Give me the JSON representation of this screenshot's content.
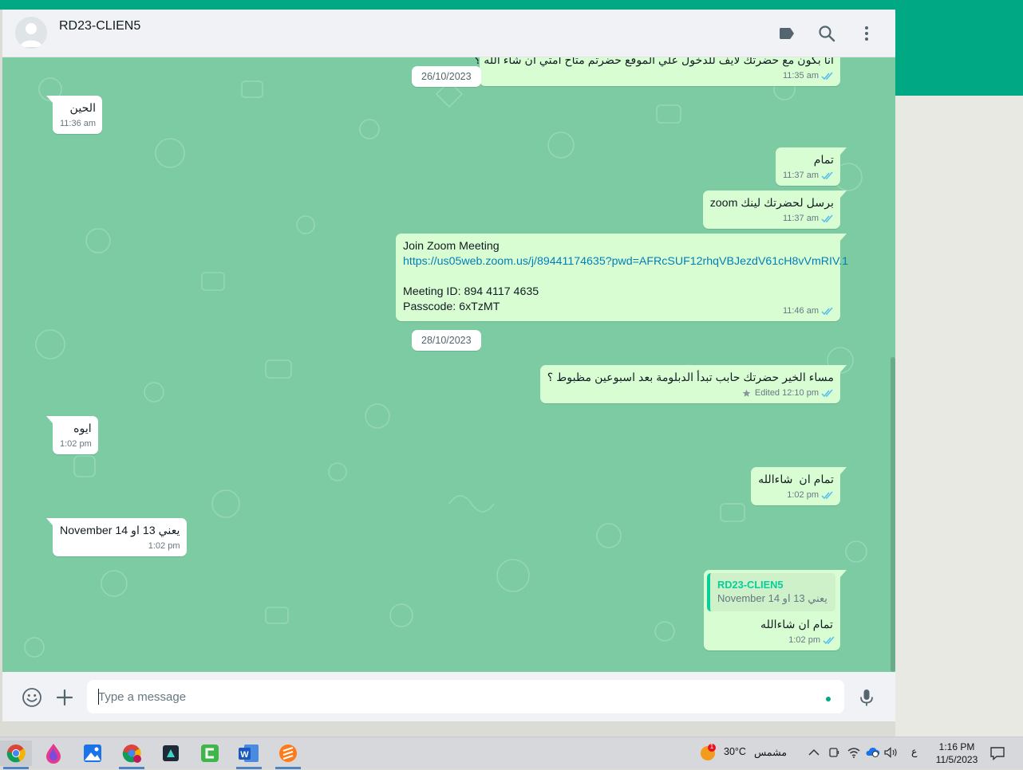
{
  "header": {
    "contact_name": "RD23-CLIEN5"
  },
  "chat": {
    "wallpaper_color": "#7dcba3",
    "dates": [
      "26/10/2023",
      "28/10/2023"
    ],
    "messages": [
      {
        "dir": "out",
        "text": "انا بكون مع حضرتك لايف للدخول علي الموقع حضرتم متاح امتي ان شاء الله ؟",
        "time": "11:35 am"
      },
      {
        "dir": "in",
        "text": "الحين",
        "time": "11:36 am"
      },
      {
        "dir": "out",
        "text": "تمام",
        "time": "11:37 am"
      },
      {
        "dir": "out",
        "text": "برسل لحضرتك لينك zoom",
        "time": "11:37 am"
      },
      {
        "dir": "out",
        "line1": "Join Zoom Meeting",
        "link": "https://us05web.zoom.us/j/89441174635?pwd=AFRcSUF12rhqVBJezdV61cH8vVmRIV.1",
        "line3": "Meeting ID: 894 4117 4635",
        "line4": "Passcode: 6xTzMT",
        "time": "11:46 am"
      },
      {
        "dir": "out",
        "text": "مساء الخير حضرتك حابب تبدأ الدبلومة بعد اسبوعين مظبوط ؟",
        "edited": "Edited",
        "time": "12:10 pm"
      },
      {
        "dir": "in",
        "text": "ايوه",
        "time": "1:02 pm"
      },
      {
        "dir": "out",
        "text": "تمام ان  شاءالله",
        "time": "1:02 pm"
      },
      {
        "dir": "in",
        "text": "يعني 13 او 14 November",
        "time": "1:02 pm"
      },
      {
        "dir": "out",
        "quote_author": "RD23-CLIEN5",
        "quote_text": "يعني 13 او 14 November",
        "text": "تمام ان شاءالله",
        "time": "1:02 pm"
      }
    ]
  },
  "composer": {
    "placeholder": "Type a message"
  },
  "taskbar": {
    "weather_temp": "30°C",
    "weather_label": "مشمس",
    "weather_badge": "1",
    "lang": "ع",
    "time": "1:16 PM",
    "date": "11/5/2023"
  },
  "colors": {
    "accent": "#00a884",
    "outgoing_bubble": "#d9fdd3",
    "read_tick": "#53bdeb"
  }
}
